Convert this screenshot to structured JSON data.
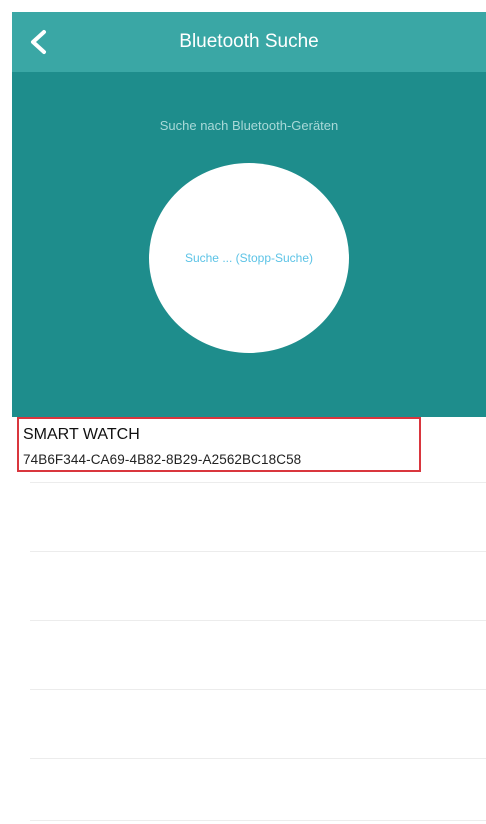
{
  "header": {
    "back_icon": "chevron-left-icon",
    "title": "Bluetooth Suche"
  },
  "scan": {
    "subtitle": "Suche nach Bluetooth-Geräten",
    "button_label": "Suche ... (Stopp-Suche)"
  },
  "devices": [
    {
      "name": "SMART WATCH",
      "id": "74B6F344-CA69-4B82-8B29-A2562BC18C58"
    }
  ],
  "colors": {
    "navbar": "#3aa7a5",
    "panel": "#1e8d8c",
    "scan_label": "#5cc3e6",
    "highlight_border": "#d9363e"
  }
}
